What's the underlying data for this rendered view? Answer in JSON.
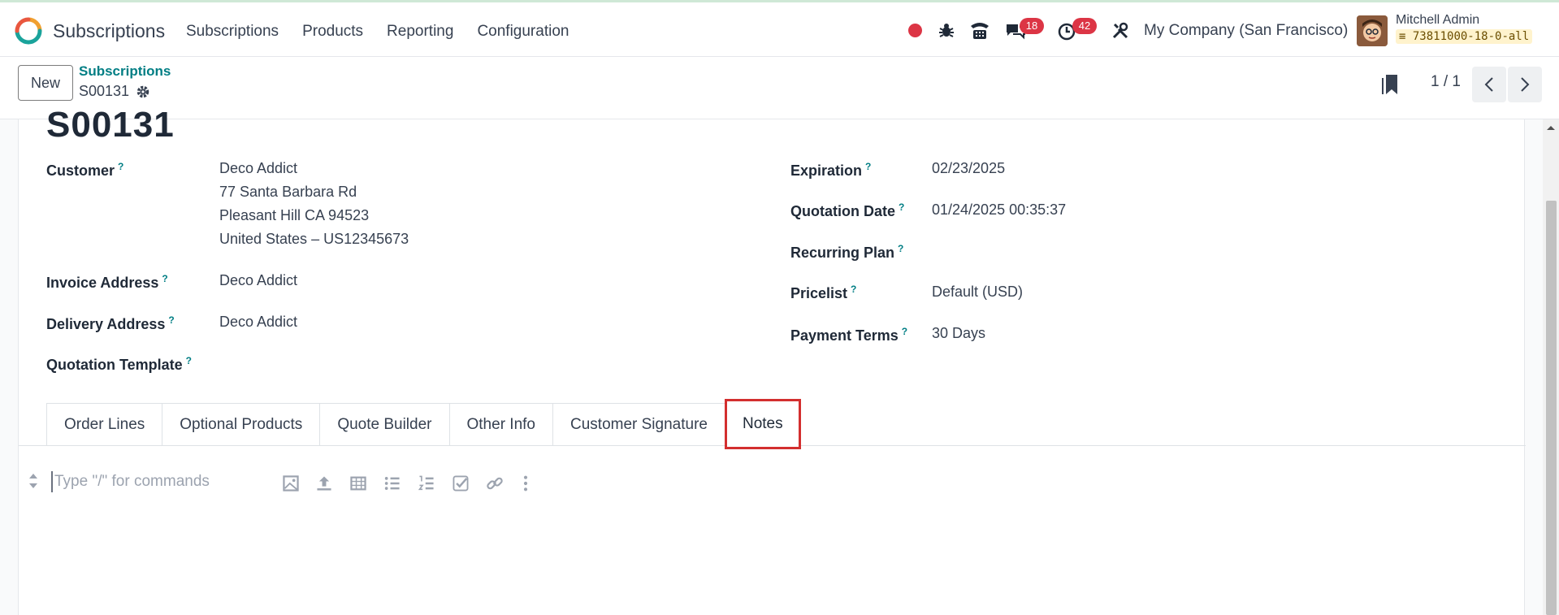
{
  "app": {
    "title": "Subscriptions"
  },
  "menu": [
    "Subscriptions",
    "Products",
    "Reporting",
    "Configuration"
  ],
  "systray": {
    "messages_count": "18",
    "activities_count": "42",
    "company": "My Company (San Francisco)",
    "user_name": "Mitchell Admin",
    "database": "73811000-18-0-all"
  },
  "control_panel": {
    "new_label": "New",
    "breadcrumb": "Subscriptions",
    "record_id": "S00131",
    "pager": "1 / 1"
  },
  "record": {
    "title": "S00131",
    "help_mark": "?",
    "customer_label": "Customer",
    "customer_lines": [
      "Deco Addict",
      "77 Santa Barbara Rd",
      "Pleasant Hill CA 94523",
      "United States – US12345673"
    ],
    "invoice_address_label": "Invoice Address",
    "invoice_address": "Deco Addict",
    "delivery_address_label": "Delivery Address",
    "delivery_address": "Deco Addict",
    "quotation_template_label": "Quotation Template",
    "expiration_label": "Expiration",
    "expiration": "02/23/2025",
    "quotation_date_label": "Quotation Date",
    "quotation_date": "01/24/2025 00:35:37",
    "recurring_plan_label": "Recurring Plan",
    "pricelist_label": "Pricelist",
    "pricelist": "Default (USD)",
    "payment_terms_label": "Payment Terms",
    "payment_terms": "30 Days"
  },
  "tabs": [
    "Order Lines",
    "Optional Products",
    "Quote Builder",
    "Other Info",
    "Customer Signature",
    "Notes"
  ],
  "active_tab": "Notes",
  "editor": {
    "placeholder": "Type \"/\" for commands"
  },
  "colors": {
    "accent": "#017e84",
    "badge": "#dc3545",
    "highlight": "#d32f2f"
  }
}
